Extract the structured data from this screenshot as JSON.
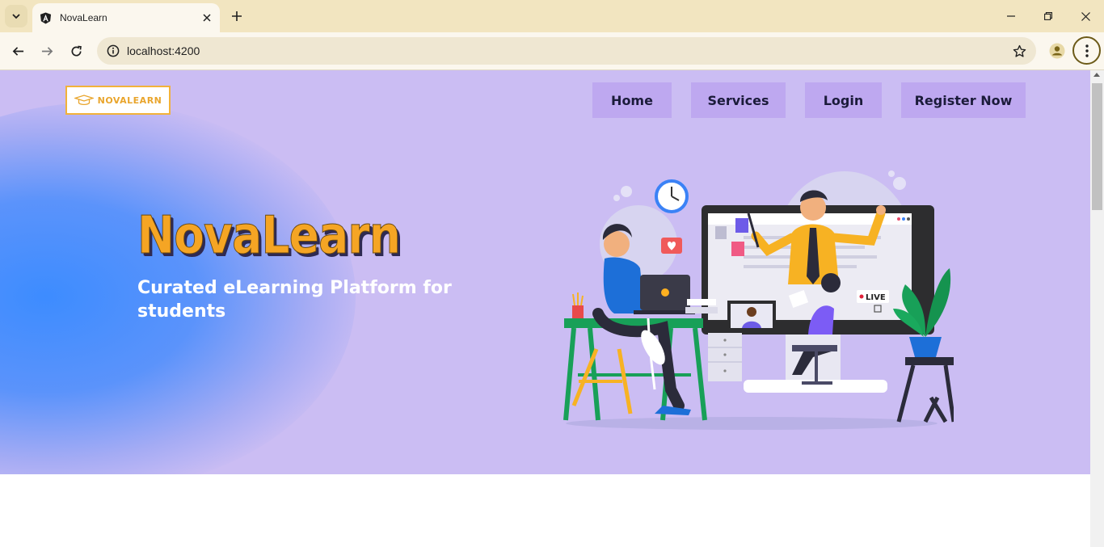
{
  "browser": {
    "tab_title": "NovaLearn",
    "url": "localhost:4200",
    "icons": {
      "tab_search": "chevron-down-icon",
      "favicon": "angular-icon",
      "close": "close-icon",
      "new_tab": "plus-icon",
      "minimize": "minimize-icon",
      "restore": "restore-icon",
      "window_close": "close-icon",
      "back": "arrow-left-icon",
      "forward": "arrow-right-icon",
      "reload": "reload-icon",
      "site_info": "info-icon",
      "bookmark": "star-icon",
      "profile": "person-icon",
      "menu": "kebab-icon"
    }
  },
  "page": {
    "logo_text": "NOVALEARN",
    "nav": {
      "home": "Home",
      "services": "Services",
      "login": "Login",
      "register": "Register Now"
    },
    "hero": {
      "title": "NovaLearn",
      "subtitle": "Curated eLearning Platform for students",
      "illustration_live_label": "LIVE"
    },
    "colors": {
      "hero_bg": "#cbbdf3",
      "nav_button_bg": "#bea8f0",
      "title_orange": "#f5a524",
      "blob_blue": "#3d8cff",
      "chrome_tabbar": "#f2e5c0"
    }
  }
}
